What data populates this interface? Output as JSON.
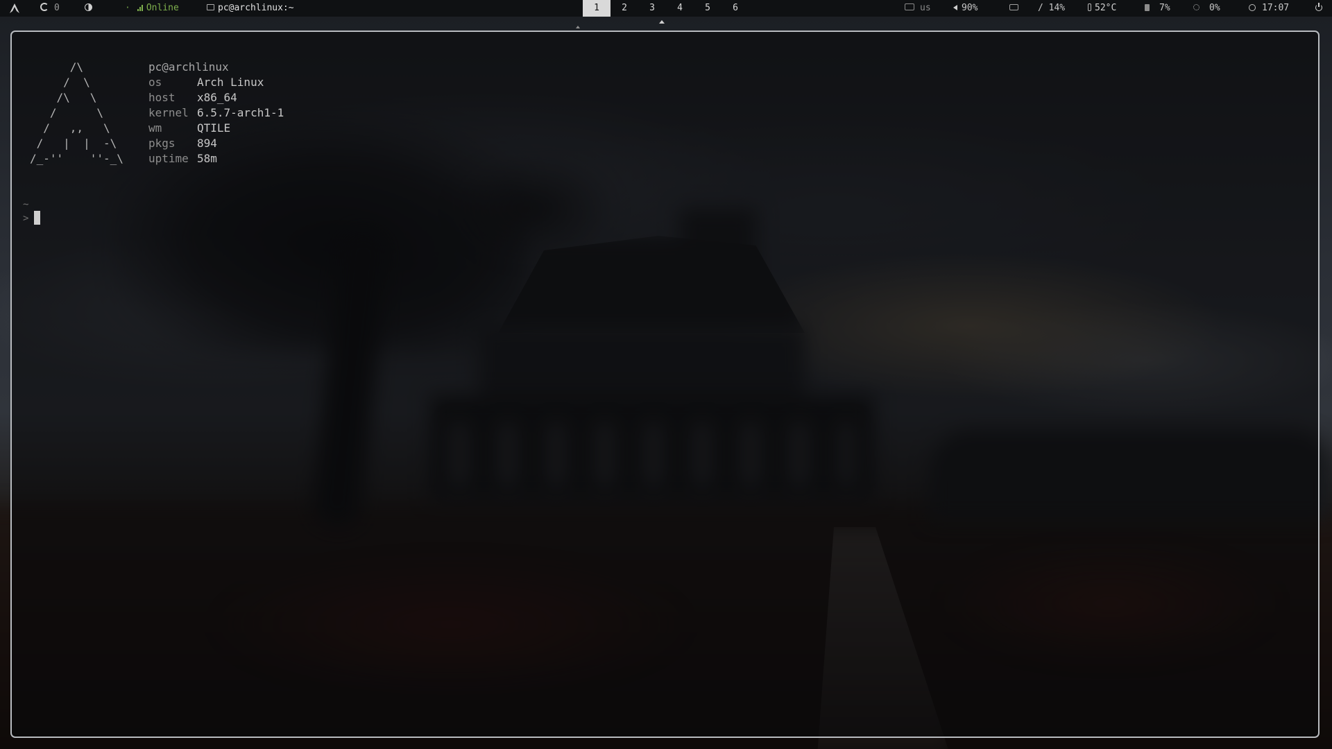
{
  "topbar": {
    "logo_icon": "arch-linux-icon",
    "updates": {
      "icon": "update-icon",
      "count": "0"
    },
    "power_profile_icon": "power-profile-icon",
    "network": {
      "dot": "·",
      "icon": "signal-icon",
      "status": "Online"
    },
    "window": {
      "icon": "window-icon",
      "title": "pc@archlinux:~"
    },
    "groups": [
      "1",
      "2",
      "3",
      "4",
      "5",
      "6"
    ],
    "active_group": "1",
    "keyboard_layout": "us",
    "volume": "90%",
    "disk": "/ 14%",
    "temperature": "52°C",
    "memory": "7%",
    "cpu": "0%",
    "clock": "17:07",
    "power_icon": "power-icon"
  },
  "terminal": {
    "ascii_logo": "      /\\\n     /  \\\n    /\\   \\\n   /      \\\n  /   ,,   \\\n /   |  |  -\\\n/_-''    ''-_\\",
    "user_host": "pc@archlinux",
    "info": [
      {
        "key": "os",
        "value": "Arch Linux"
      },
      {
        "key": "host",
        "value": "x86_64"
      },
      {
        "key": "kernel",
        "value": "6.5.7-arch1-1"
      },
      {
        "key": "wm",
        "value": "QTILE"
      },
      {
        "key": "pkgs",
        "value": "894"
      },
      {
        "key": "uptime",
        "value": "58m"
      }
    ],
    "prompt_dir": "~",
    "prompt_symbol": ">"
  },
  "colors": {
    "bar_bg": "#0f1113",
    "network_green": "#7fb04d",
    "active_group_bg": "#d9d9d9",
    "terminal_border": "#b9bcc0"
  }
}
